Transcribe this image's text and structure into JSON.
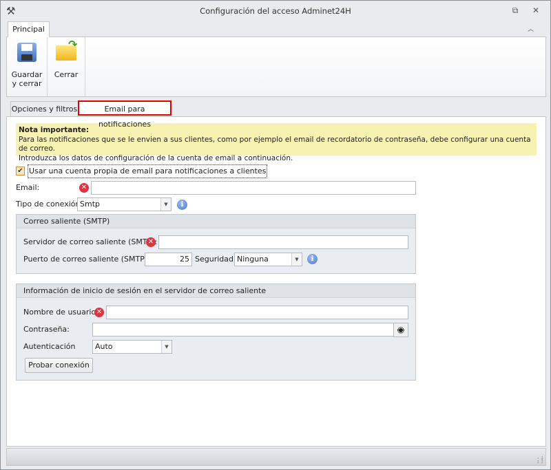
{
  "window": {
    "title": "Configuración del acceso Adminet24H",
    "app_icon": "tools-icon",
    "restore_icon": "restore-icon",
    "close_icon": "close-icon"
  },
  "ribbon": {
    "tabs": [
      {
        "label": "Principal",
        "active": true
      }
    ],
    "collapse_icon": "chevron-up-icon",
    "buttons": [
      {
        "label1": "Guardar",
        "label2": "y cerrar",
        "icon": "floppy-disk-icon"
      },
      {
        "label": "Cerrar",
        "icon": "folder-arrow-icon"
      }
    ]
  },
  "tabs": [
    {
      "label": "Opciones y filtros",
      "active": false
    },
    {
      "label": "Email para notificaciones",
      "active": true,
      "highlight": "#e00000"
    }
  ],
  "note": {
    "title": "Nota importante:",
    "line1": "Para las notificaciones que se le envien a sus clientes, como por ejemplo el email de recordatorio de contraseña, debe configurar una cuenta de correo.",
    "line2": "Introduzca los datos de configuración de la cuenta de email a continuación.",
    "background": "#f7f1b2"
  },
  "form": {
    "use_own_account": {
      "label": "Usar una cuenta propia de email para notificaciones a clientes",
      "checked": true
    },
    "email": {
      "label": "Email:",
      "value": ""
    },
    "connection_type": {
      "label": "Tipo de conexión:",
      "value": "Smtp"
    },
    "smtp_group": {
      "title": "Correo saliente (SMTP)",
      "server": {
        "label": "Servidor de correo saliente (SMTP):",
        "value": ""
      },
      "port": {
        "label": "Puerto de correo saliente (SMTP):",
        "value": "25"
      },
      "security": {
        "label": "Seguridad:",
        "value": "Ninguna"
      }
    },
    "login_group": {
      "title": "Información de inicio de sesión en el servidor de correo saliente",
      "username": {
        "label": "Nombre de usuario:",
        "value": ""
      },
      "password": {
        "label": "Contraseña:",
        "value": ""
      },
      "auth": {
        "label": "Autenticación",
        "value": "Auto"
      },
      "test_button": "Probar conexión"
    }
  }
}
